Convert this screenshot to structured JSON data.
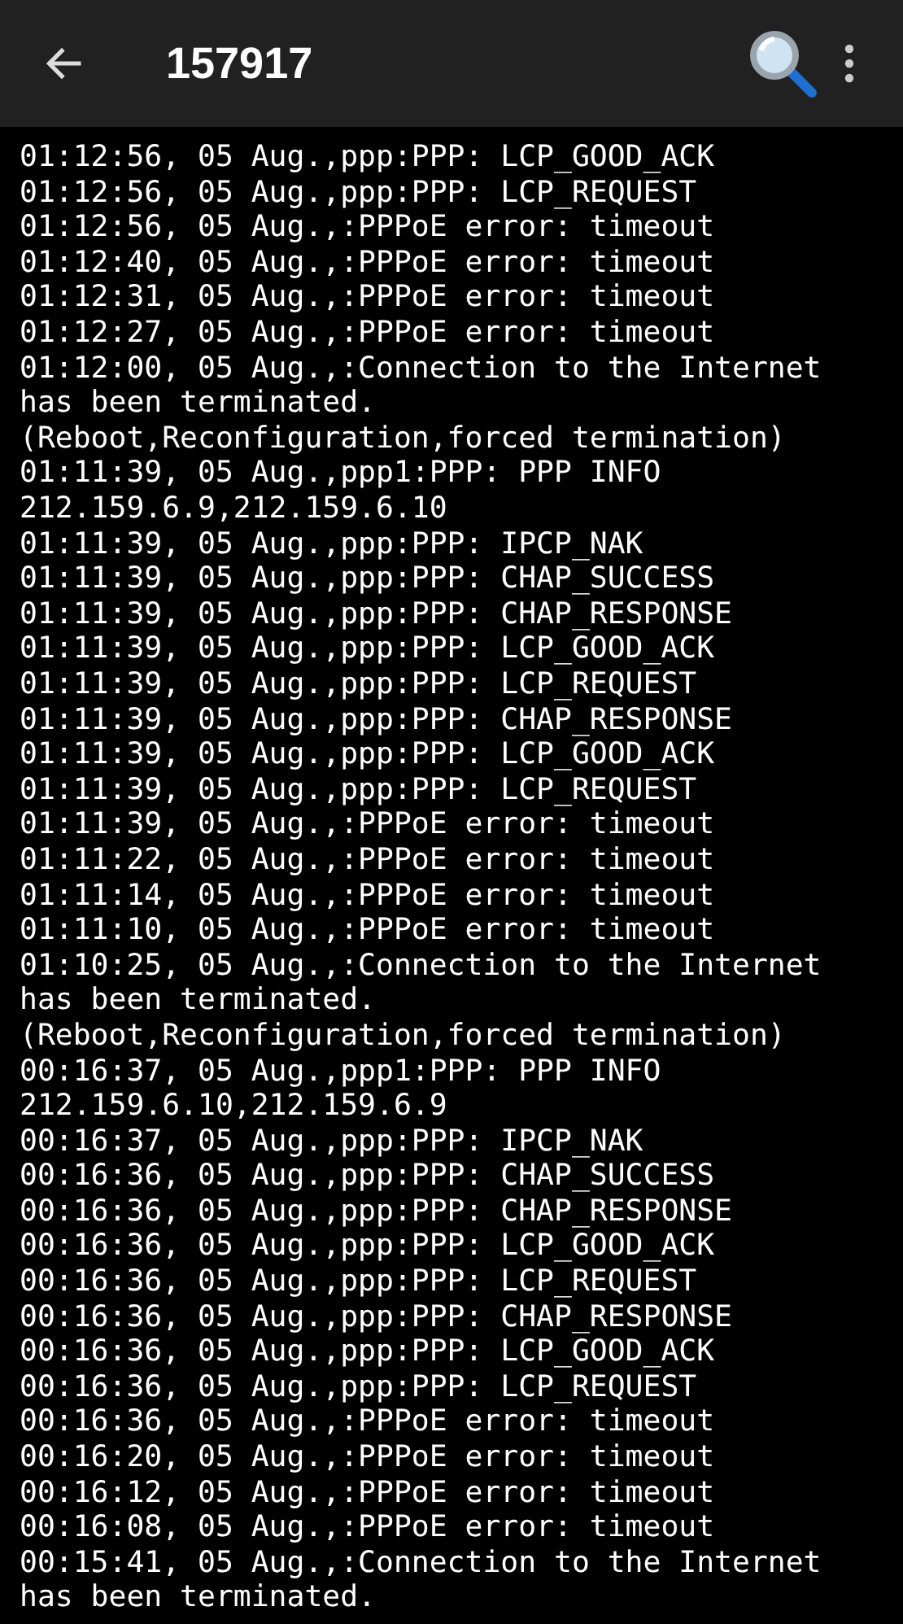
{
  "app_bar": {
    "title": "157917"
  },
  "log_entries": [
    "01:12:56, 05 Aug.,ppp:PPP: LCP_GOOD_ACK",
    "01:12:56, 05 Aug.,ppp:PPP: LCP_REQUEST",
    "01:12:56, 05 Aug.,:PPPoE error: timeout",
    "01:12:40, 05 Aug.,:PPPoE error: timeout",
    "01:12:31, 05 Aug.,:PPPoE error: timeout",
    "01:12:27, 05 Aug.,:PPPoE error: timeout",
    "01:12:00, 05 Aug.,:Connection to the Internet has been terminated.",
    "(Reboot,Reconfiguration,forced termination)",
    "01:11:39, 05 Aug.,ppp1:PPP: PPP INFO 212.159.6.9,212.159.6.10",
    "01:11:39, 05 Aug.,ppp:PPP: IPCP_NAK",
    "01:11:39, 05 Aug.,ppp:PPP: CHAP_SUCCESS",
    "01:11:39, 05 Aug.,ppp:PPP: CHAP_RESPONSE",
    "01:11:39, 05 Aug.,ppp:PPP: LCP_GOOD_ACK",
    "01:11:39, 05 Aug.,ppp:PPP: LCP_REQUEST",
    "01:11:39, 05 Aug.,ppp:PPP: CHAP_RESPONSE",
    "01:11:39, 05 Aug.,ppp:PPP: LCP_GOOD_ACK",
    "01:11:39, 05 Aug.,ppp:PPP: LCP_REQUEST",
    "01:11:39, 05 Aug.,:PPPoE error: timeout",
    "01:11:22, 05 Aug.,:PPPoE error: timeout",
    "01:11:14, 05 Aug.,:PPPoE error: timeout",
    "01:11:10, 05 Aug.,:PPPoE error: timeout",
    "01:10:25, 05 Aug.,:Connection to the Internet has been terminated.",
    "(Reboot,Reconfiguration,forced termination)",
    "00:16:37, 05 Aug.,ppp1:PPP: PPP INFO 212.159.6.10,212.159.6.9",
    "00:16:37, 05 Aug.,ppp:PPP: IPCP_NAK",
    "00:16:36, 05 Aug.,ppp:PPP: CHAP_SUCCESS",
    "00:16:36, 05 Aug.,ppp:PPP: CHAP_RESPONSE",
    "00:16:36, 05 Aug.,ppp:PPP: LCP_GOOD_ACK",
    "00:16:36, 05 Aug.,ppp:PPP: LCP_REQUEST",
    "00:16:36, 05 Aug.,ppp:PPP: CHAP_RESPONSE",
    "00:16:36, 05 Aug.,ppp:PPP: LCP_GOOD_ACK",
    "00:16:36, 05 Aug.,ppp:PPP: LCP_REQUEST",
    "00:16:36, 05 Aug.,:PPPoE error: timeout",
    "00:16:20, 05 Aug.,:PPPoE error: timeout",
    "00:16:12, 05 Aug.,:PPPoE error: timeout",
    "00:16:08, 05 Aug.,:PPPoE error: timeout",
    "00:15:41, 05 Aug.,:Connection to the Internet has been terminated."
  ]
}
